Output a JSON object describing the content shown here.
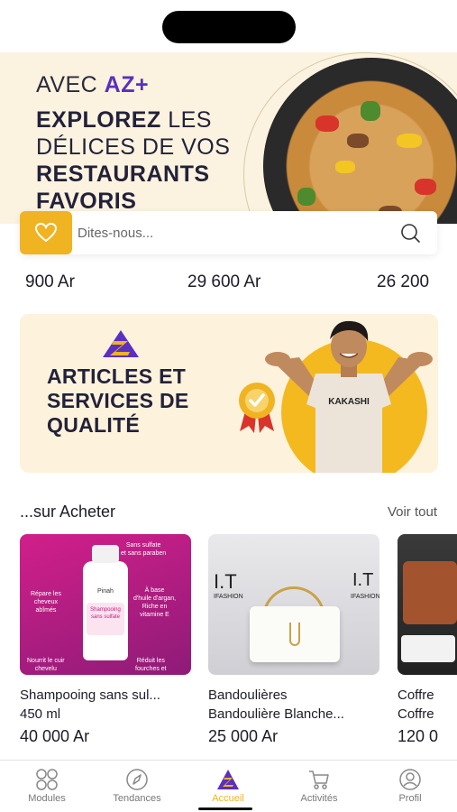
{
  "hero": {
    "line1_prefix": "AVEC ",
    "line1_brand": "AZ+",
    "line2_bold": "EXPLOREZ",
    "line2_rest": " LES",
    "line3": "DÉLICES DE VOS",
    "line4": "RESTAURANTS",
    "line5": "FAVORIS"
  },
  "search": {
    "placeholder": "Dites-nous..."
  },
  "prices": [
    "900 Ar",
    "29 600 Ar",
    "26 200"
  ],
  "promo": {
    "line1": "ARTICLES ET",
    "line2": "SERVICES DE",
    "line3": "QUALITÉ",
    "shirt_text": "KAKASHI"
  },
  "section": {
    "title": "...sur Acheter",
    "see_all": "Voir tout"
  },
  "products": [
    {
      "name": "Shampooing sans sul...",
      "sub": "450 ml",
      "price": "40 000 Ar",
      "annotations": [
        "Sans sulfate",
        "et sans paraben",
        "Répare les",
        "cheveux",
        "abîmés",
        "À base",
        "d'huile d'argan,",
        "Riche en",
        "vitamine E",
        "Nourrit le cuir",
        "chevelu",
        "Réduit les",
        "fourches et"
      ],
      "bottle_brand": "Pinah",
      "bottle_label": "Shampooing sans sulfate"
    },
    {
      "name": "Bandoulières",
      "sub": "Bandoulière Blanche...",
      "price": "25 000 Ar",
      "brand_big": "I.T",
      "brand_small": "IFASHION"
    },
    {
      "name": "Coffre",
      "sub": "Coffre",
      "price": "120 0"
    }
  ],
  "nav": {
    "items": [
      {
        "label": "Modules",
        "icon": "grid-icon"
      },
      {
        "label": "Tendances",
        "icon": "compass-icon"
      },
      {
        "label": "Accueil",
        "icon": "az-logo-icon"
      },
      {
        "label": "Activités",
        "icon": "cart-icon"
      },
      {
        "label": "Profil",
        "icon": "profile-icon"
      }
    ],
    "active_index": 2
  },
  "colors": {
    "accent": "#f0b321",
    "brand": "#5a2fc2",
    "hero_bg": "#fbf3df",
    "promo_bg": "#fdf2dc"
  }
}
